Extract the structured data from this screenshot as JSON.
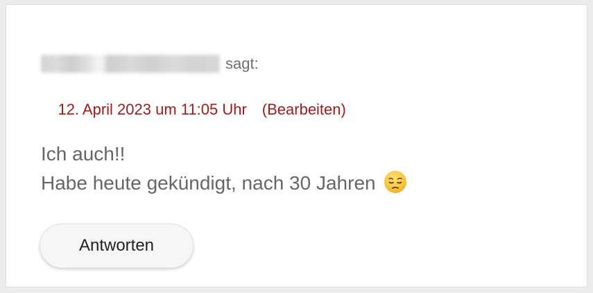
{
  "comment": {
    "author_name": "Brigitte Becker",
    "author_suffix": "sagt:",
    "date_link": "12. April 2023 um 11:05 Uhr",
    "edit_link": "(Bearbeiten)",
    "body_lines": [
      "Ich auch!!",
      "Habe heute gekündigt, nach 30 Jahren"
    ],
    "emoji": "pensive-face-icon",
    "reply_label": "Antworten"
  },
  "colors": {
    "link": "#9a1c1c",
    "text": "#666666",
    "background": "#ffffff",
    "page_background": "#ececec",
    "button_background": "#f6f6f6"
  }
}
